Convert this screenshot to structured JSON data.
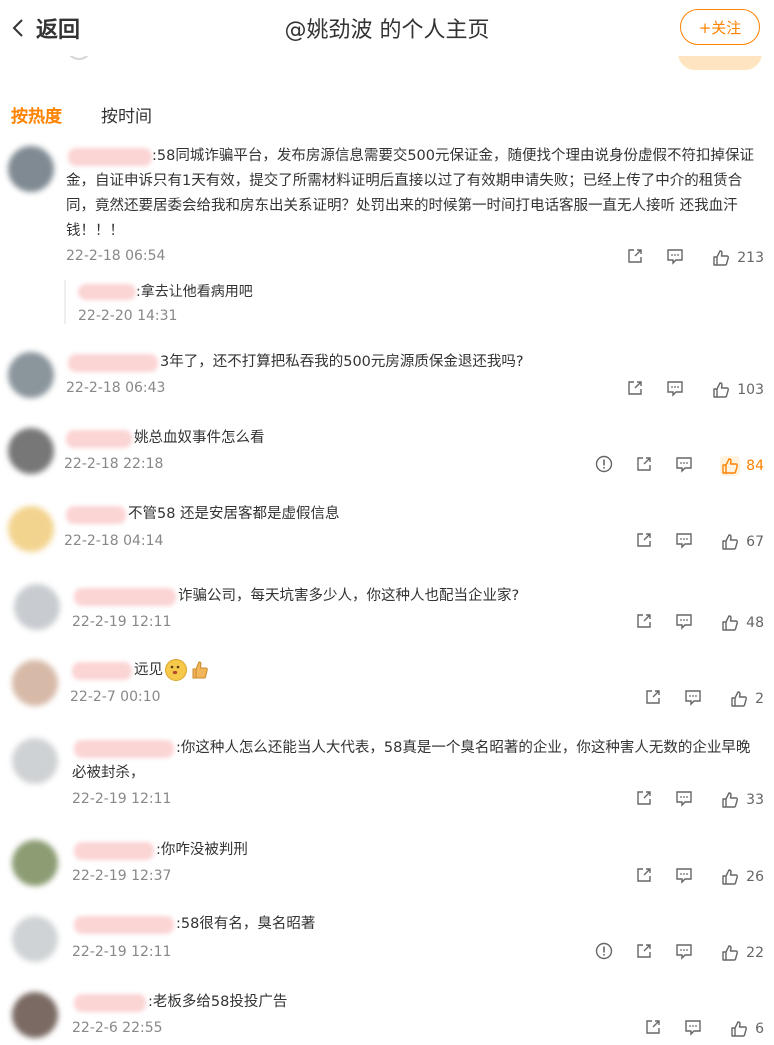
{
  "header": {
    "back_label": "返回",
    "title": "@姚劲波 的个人主页",
    "follow_label": "+关注"
  },
  "sort_tabs": [
    {
      "label": "按热度",
      "active": true
    },
    {
      "label": "按时间",
      "active": false
    }
  ],
  "colors": {
    "accent": "#ff8200",
    "text": "#333333",
    "meta": "#888888",
    "name_blur": "#fbd4d4"
  },
  "comments": [
    {
      "text": ":58同城诈骗平台，发布房源信息需要交500元保证金，随便找个理由说身份虚假不符扣掉保证金，自证申诉只有1天有效，提交了所需材料证明后直接以过了有效期申请失败；已经上传了中介的租赁合同，竟然还要居委会给我和房东出关系证明？处罚出来的时候第一时间打电话客服一直无人接听  还我血汗钱！！！",
      "time": "22-2-18 06:54",
      "likes": "213",
      "liked": false,
      "report": false,
      "reply": {
        "text": ":拿去让他看病用吧",
        "time": "22-2-20 14:31"
      }
    },
    {
      "text": "3年了，还不打算把私吞我的500元房源质保金退还我吗?",
      "time": "22-2-18 06:43",
      "likes": "103",
      "liked": false,
      "report": false
    },
    {
      "text": "姚总血奴事件怎么看",
      "time": "22-2-18 22:18",
      "likes": "84",
      "liked": true,
      "report": true
    },
    {
      "text": "不管58 还是安居客都是虚假信息",
      "time": "22-2-18 04:14",
      "likes": "67",
      "liked": false,
      "report": false
    },
    {
      "text": "诈骗公司，每天坑害多少人，你这种人也配当企业家?",
      "time": "22-2-19 12:11",
      "likes": "48",
      "liked": false,
      "report": false
    },
    {
      "text": "远见",
      "time": "22-2-7 00:10",
      "likes": "2",
      "liked": false,
      "report": false
    },
    {
      "text": ":你这种人怎么还能当人大代表，58真是一个臭名昭著的企业，你这种害人无数的企业早晚必被封杀，",
      "time": "22-2-19 12:11",
      "likes": "33",
      "liked": false,
      "report": false
    },
    {
      "text": ":你咋没被判刑",
      "time": "22-2-19 12:37",
      "likes": "26",
      "liked": false,
      "report": false
    },
    {
      "text": ":58很有名，臭名昭著",
      "time": "22-2-19 12:11",
      "likes": "22",
      "liked": false,
      "report": true
    },
    {
      "text": ":老板多给58投投广告",
      "time": "22-2-6 22:55",
      "likes": "6",
      "liked": false,
      "report": false
    }
  ]
}
